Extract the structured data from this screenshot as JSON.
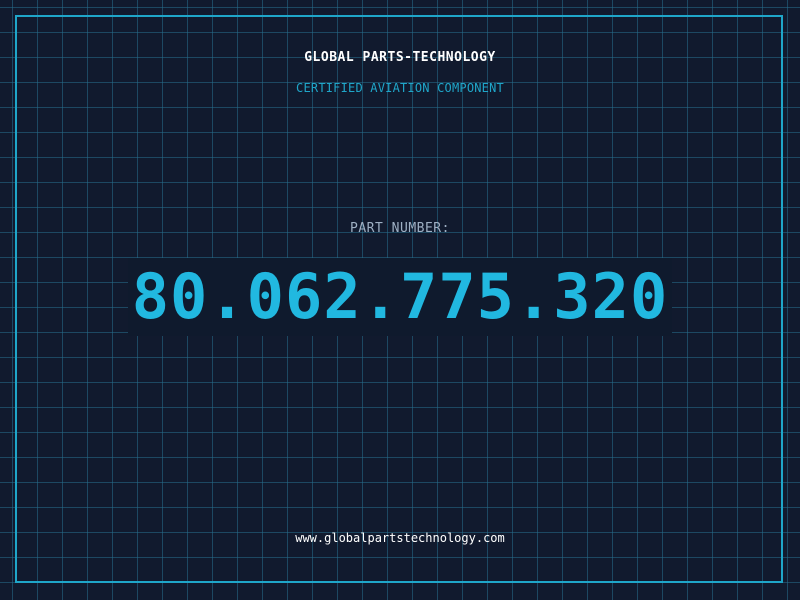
{
  "header": {
    "brand": "GLOBAL PARTS-TECHNOLOGY",
    "subtitle": "CERTIFIED AVIATION COMPONENT"
  },
  "part": {
    "label": "PART NUMBER:",
    "number": "80.062.775.320"
  },
  "footer": {
    "website": "www.globalpartstechnology.com"
  },
  "colors": {
    "background": "#111a2e",
    "accent": "#21b8e0",
    "frame": "#1fa6c9",
    "text": "#ffffff",
    "muted": "#9fb0c4"
  }
}
